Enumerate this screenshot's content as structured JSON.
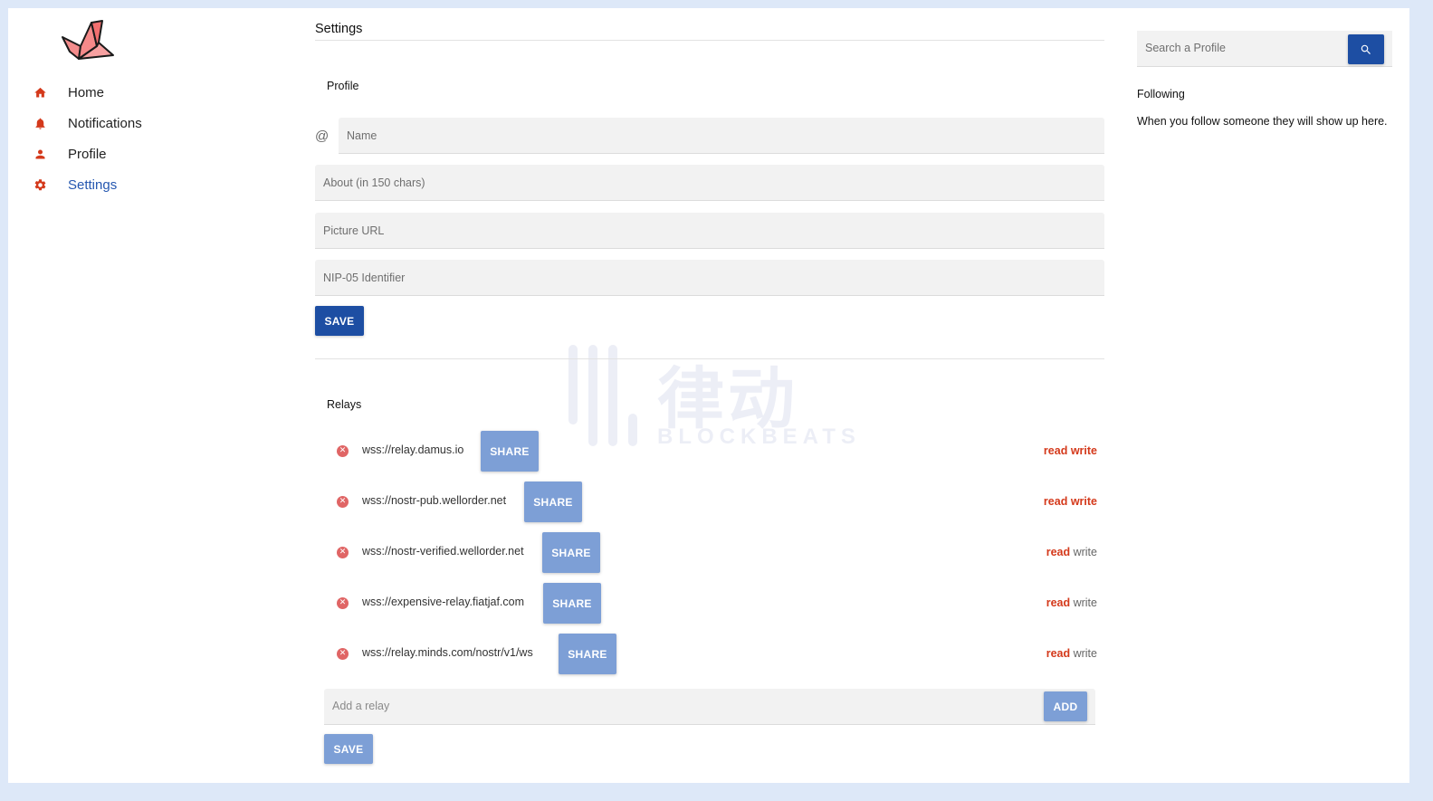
{
  "sidebar": {
    "items": [
      {
        "label": "Home",
        "icon": "home-icon"
      },
      {
        "label": "Notifications",
        "icon": "bell-icon"
      },
      {
        "label": "Profile",
        "icon": "person-icon"
      },
      {
        "label": "Settings",
        "icon": "gear-icon",
        "active": true
      }
    ],
    "icon_color": "#d4391b",
    "active_color": "#2557b0"
  },
  "settings": {
    "title": "Settings",
    "profile": {
      "heading": "Profile",
      "at_symbol": "@",
      "name_placeholder": "Name",
      "about_placeholder": "About (in 150 chars)",
      "picture_placeholder": "Picture URL",
      "nip05_placeholder": "NIP-05 Identifier",
      "save_label": "SAVE"
    },
    "relays": {
      "heading": "Relays",
      "items": [
        {
          "url": "wss://relay.damus.io",
          "share_label": "SHARE",
          "read_label": "read",
          "write_label": "write",
          "read": true,
          "write": true
        },
        {
          "url": "wss://nostr-pub.wellorder.net",
          "share_label": "SHARE",
          "read_label": "read",
          "write_label": "write",
          "read": true,
          "write": true
        },
        {
          "url": "wss://nostr-verified.wellorder.net",
          "share_label": "SHARE",
          "read_label": "read",
          "write_label": "write",
          "read": true,
          "write": false
        },
        {
          "url": "wss://expensive-relay.fiatjaf.com",
          "share_label": "SHARE",
          "read_label": "read",
          "write_label": "write",
          "read": true,
          "write": false
        },
        {
          "url": "wss://relay.minds.com/nostr/v1/ws",
          "share_label": "SHARE",
          "read_label": "read",
          "write_label": "write",
          "read": true,
          "write": false
        }
      ],
      "add_placeholder": "Add a relay",
      "add_label": "ADD",
      "save_label": "SAVE"
    }
  },
  "right": {
    "search_placeholder": "Search a Profile",
    "following_title": "Following",
    "following_empty": "When you follow someone they will show up here."
  },
  "watermark": {
    "cn": "律动",
    "en": "BLOCKBEATS"
  },
  "colors": {
    "primary": "#1d4ea3",
    "muted_button": "#7d9fd6",
    "accent": "#d4391b",
    "background": "#dde8f8"
  }
}
